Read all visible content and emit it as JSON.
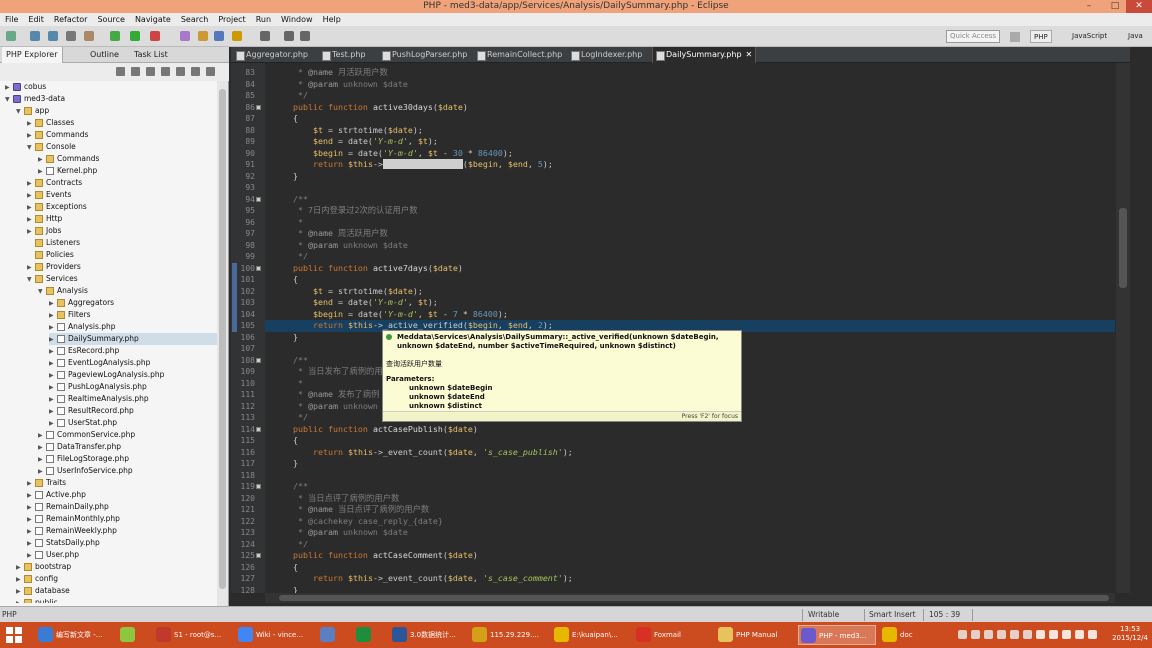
{
  "window": {
    "title": "PHP - med3-data/app/Services/Analysis/DailySummary.php - Eclipse",
    "minimize": "–",
    "maximize": "□",
    "close": "✕"
  },
  "menu": [
    "File",
    "Edit",
    "Refactor",
    "Source",
    "Navigate",
    "Search",
    "Project",
    "Run",
    "Window",
    "Help"
  ],
  "toolbar": {
    "quick_access": "Quick Access",
    "perspectives": [
      "PHP",
      "JavaScript",
      "Java"
    ]
  },
  "explorer": {
    "tabs": [
      "PHP Explorer",
      "Outline",
      "Task List"
    ],
    "tree": [
      {
        "label": "cobus",
        "type": "proj",
        "depth": 0,
        "arrow": "▶"
      },
      {
        "label": "med3-data",
        "type": "proj",
        "depth": 0,
        "arrow": "▼"
      },
      {
        "label": "app",
        "type": "folder",
        "depth": 1,
        "arrow": "▼"
      },
      {
        "label": "Classes",
        "type": "folder",
        "depth": 2,
        "arrow": "▶"
      },
      {
        "label": "Commands",
        "type": "folder",
        "depth": 2,
        "arrow": "▶"
      },
      {
        "label": "Console",
        "type": "folder",
        "depth": 2,
        "arrow": "▼"
      },
      {
        "label": "Commands",
        "type": "folder",
        "depth": 3,
        "arrow": "▶"
      },
      {
        "label": "Kernel.php",
        "type": "php",
        "depth": 3,
        "arrow": "▶"
      },
      {
        "label": "Contracts",
        "type": "folder",
        "depth": 2,
        "arrow": "▶"
      },
      {
        "label": "Events",
        "type": "folder",
        "depth": 2,
        "arrow": "▶"
      },
      {
        "label": "Exceptions",
        "type": "folder",
        "depth": 2,
        "arrow": "▶"
      },
      {
        "label": "Http",
        "type": "folder",
        "depth": 2,
        "arrow": "▶"
      },
      {
        "label": "Jobs",
        "type": "folder",
        "depth": 2,
        "arrow": "▶"
      },
      {
        "label": "Listeners",
        "type": "folder",
        "depth": 2,
        "arrow": ""
      },
      {
        "label": "Policies",
        "type": "folder",
        "depth": 2,
        "arrow": ""
      },
      {
        "label": "Providers",
        "type": "folder",
        "depth": 2,
        "arrow": "▶"
      },
      {
        "label": "Services",
        "type": "folder",
        "depth": 2,
        "arrow": "▼"
      },
      {
        "label": "Analysis",
        "type": "folder",
        "depth": 3,
        "arrow": "▼"
      },
      {
        "label": "Aggregators",
        "type": "folder",
        "depth": 4,
        "arrow": "▶"
      },
      {
        "label": "Filters",
        "type": "folder",
        "depth": 4,
        "arrow": "▶"
      },
      {
        "label": "Analysis.php",
        "type": "php",
        "depth": 4,
        "arrow": "▶"
      },
      {
        "label": "DailySummary.php",
        "type": "php",
        "depth": 4,
        "arrow": "▶",
        "selected": true
      },
      {
        "label": "EsRecord.php",
        "type": "php",
        "depth": 4,
        "arrow": "▶"
      },
      {
        "label": "EventLogAnalysis.php",
        "type": "php",
        "depth": 4,
        "arrow": "▶"
      },
      {
        "label": "PageviewLogAnalysis.php",
        "type": "php",
        "depth": 4,
        "arrow": "▶"
      },
      {
        "label": "PushLogAnalysis.php",
        "type": "php",
        "depth": 4,
        "arrow": "▶"
      },
      {
        "label": "RealtimeAnalysis.php",
        "type": "php",
        "depth": 4,
        "arrow": "▶"
      },
      {
        "label": "ResultRecord.php",
        "type": "php",
        "depth": 4,
        "arrow": "▶"
      },
      {
        "label": "UserStat.php",
        "type": "php",
        "depth": 4,
        "arrow": "▶"
      },
      {
        "label": "CommonService.php",
        "type": "php",
        "depth": 3,
        "arrow": "▶"
      },
      {
        "label": "DataTransfer.php",
        "type": "php",
        "depth": 3,
        "arrow": "▶"
      },
      {
        "label": "FileLogStorage.php",
        "type": "php",
        "depth": 3,
        "arrow": "▶"
      },
      {
        "label": "UserInfoService.php",
        "type": "php",
        "depth": 3,
        "arrow": "▶"
      },
      {
        "label": "Traits",
        "type": "folder",
        "depth": 2,
        "arrow": "▶"
      },
      {
        "label": "Active.php",
        "type": "php",
        "depth": 2,
        "arrow": "▶"
      },
      {
        "label": "RemainDaily.php",
        "type": "php",
        "depth": 2,
        "arrow": "▶"
      },
      {
        "label": "RemainMonthly.php",
        "type": "php",
        "depth": 2,
        "arrow": "▶"
      },
      {
        "label": "RemainWeekly.php",
        "type": "php",
        "depth": 2,
        "arrow": "▶"
      },
      {
        "label": "StatsDaily.php",
        "type": "php",
        "depth": 2,
        "arrow": "▶"
      },
      {
        "label": "User.php",
        "type": "php",
        "depth": 2,
        "arrow": "▶"
      },
      {
        "label": "bootstrap",
        "type": "folder",
        "depth": 1,
        "arrow": "▶"
      },
      {
        "label": "config",
        "type": "folder",
        "depth": 1,
        "arrow": "▶"
      },
      {
        "label": "database",
        "type": "folder",
        "depth": 1,
        "arrow": "▶"
      },
      {
        "label": "public",
        "type": "folder",
        "depth": 1,
        "arrow": "▶"
      }
    ]
  },
  "editor": {
    "tabs": [
      "Aggregator.php",
      "Test.php",
      "PushLogParser.php",
      "RemainCollect.php",
      "LogIndexer.php",
      "DailySummary.php"
    ],
    "active_tab": 5,
    "close_glyph": "✕",
    "lines": [
      {
        "n": "83",
        "html": "<span class=\"cm\">   * </span><span class=\"cmtag\">@name</span><span class=\"cm\"> 月活跃用户数</span>"
      },
      {
        "n": "84",
        "html": "<span class=\"cm\">   * </span><span class=\"cmtag\">@param</span><span class=\"cm\"> unknown $date</span>"
      },
      {
        "n": "85",
        "html": "<span class=\"cm\">   */</span>"
      },
      {
        "n": "86",
        "html": "  <span class=\"kw\">public function</span> <span class=\"fn\">active30days</span>(<span class=\"var\">$date</span>)",
        "fold": true
      },
      {
        "n": "87",
        "html": "  {"
      },
      {
        "n": "88",
        "html": "      <span class=\"var\">$t</span> = strtotime(<span class=\"var\">$date</span>);"
      },
      {
        "n": "89",
        "html": "      <span class=\"var\">$end</span> = date(<span class=\"str\">'Y-m-d'</span>, <span class=\"var\">$t</span>);"
      },
      {
        "n": "90",
        "html": "      <span class=\"var\">$begin</span> = date(<span class=\"str\">'Y-m-d'</span>, <span class=\"var\">$t</span> - <span class=\"num\">30</span> * <span class=\"num\">86400</span>);"
      },
      {
        "n": "91",
        "html": "      <span class=\"kw\">return</span> <span class=\"var\">$this</span>-><span class=\"sel-hl\">_active_verified</span>(<span class=\"var\">$begin</span>, <span class=\"var\">$end</span>, <span class=\"num\">5</span>);"
      },
      {
        "n": "92",
        "html": "  }"
      },
      {
        "n": "93",
        "html": ""
      },
      {
        "n": "94",
        "html": "<span class=\"cm\">  /**</span>",
        "fold": true
      },
      {
        "n": "95",
        "html": "<span class=\"cm\">   * 7日内登录过2次的认证用户数</span>"
      },
      {
        "n": "96",
        "html": "<span class=\"cm\">   *</span>"
      },
      {
        "n": "97",
        "html": "<span class=\"cm\">   * </span><span class=\"cmtag\">@name</span><span class=\"cm\"> 周活跃用户数</span>"
      },
      {
        "n": "98",
        "html": "<span class=\"cm\">   * </span><span class=\"cmtag\">@param</span><span class=\"cm\"> unknown $date</span>"
      },
      {
        "n": "99",
        "html": "<span class=\"cm\">   */</span>"
      },
      {
        "n": "100",
        "html": "  <span class=\"kw\">public function</span> <span class=\"fn\">active7days</span>(<span class=\"var\">$date</span>)",
        "fold": true
      },
      {
        "n": "101",
        "html": "  {"
      },
      {
        "n": "102",
        "html": "      <span class=\"var\">$t</span> = strtotime(<span class=\"var\">$date</span>);"
      },
      {
        "n": "103",
        "html": "      <span class=\"var\">$end</span> = date(<span class=\"str\">'Y-m-d'</span>, <span class=\"var\">$t</span>);"
      },
      {
        "n": "104",
        "html": "      <span class=\"var\">$begin</span> = date(<span class=\"str\">'Y-m-d'</span>, <span class=\"var\">$t</span> - <span class=\"num\">7</span> * <span class=\"num\">86400</span>);"
      },
      {
        "n": "105",
        "html": "      <span class=\"kw\">return</span> <span class=\"var\">$this</span>->_active_verified(<span class=\"var\">$begin</span>, <span class=\"var\">$end</span>, <span class=\"num\">2</span>);",
        "current": true
      },
      {
        "n": "106",
        "html": "  }"
      },
      {
        "n": "107",
        "html": ""
      },
      {
        "n": "108",
        "html": "<span class=\"cm\">  /**</span>",
        "fold": true
      },
      {
        "n": "109",
        "html": "<span class=\"cm\">   * 当日发布了病例的用户</span>"
      },
      {
        "n": "110",
        "html": "<span class=\"cm\">   *</span>"
      },
      {
        "n": "111",
        "html": "<span class=\"cm\">   * </span><span class=\"cmtag\">@name</span><span class=\"cm\"> 发布了病例</span>"
      },
      {
        "n": "112",
        "html": "<span class=\"cm\">   * </span><span class=\"cmtag\">@param</span><span class=\"cm\"> unknown</span>"
      },
      {
        "n": "113",
        "html": "<span class=\"cm\">   */</span>"
      },
      {
        "n": "114",
        "html": "  <span class=\"kw\">public function</span> <span class=\"fn\">actCasePublish</span>(<span class=\"var\">$date</span>)",
        "fold": true
      },
      {
        "n": "115",
        "html": "  {"
      },
      {
        "n": "116",
        "html": "      <span class=\"kw\">return</span> <span class=\"var\">$this</span>->_event_count(<span class=\"var\">$date</span>, <span class=\"str\">'s_case_publish'</span>);"
      },
      {
        "n": "117",
        "html": "  }"
      },
      {
        "n": "118",
        "html": ""
      },
      {
        "n": "119",
        "html": "<span class=\"cm\">  /**</span>",
        "fold": true
      },
      {
        "n": "120",
        "html": "<span class=\"cm\">   * 当日点评了病例的用户数</span>"
      },
      {
        "n": "121",
        "html": "<span class=\"cm\">   * </span><span class=\"cmtag\">@name</span><span class=\"cm\"> 当日点评了病例的用户数</span>"
      },
      {
        "n": "122",
        "html": "<span class=\"cm\">   * @cachekey case_reply_{date}</span>"
      },
      {
        "n": "123",
        "html": "<span class=\"cm\">   * </span><span class=\"cmtag\">@param</span><span class=\"cm\"> unknown $date</span>"
      },
      {
        "n": "124",
        "html": "<span class=\"cm\">   */</span>"
      },
      {
        "n": "125",
        "html": "  <span class=\"kw\">public function</span> <span class=\"fn\">actCaseComment</span>(<span class=\"var\">$date</span>)",
        "fold": true
      },
      {
        "n": "126",
        "html": "  {"
      },
      {
        "n": "127",
        "html": "      <span class=\"kw\">return</span> <span class=\"var\">$this</span>->_event_count(<span class=\"var\">$date</span>, <span class=\"str\">'s_case_comment'</span>);"
      },
      {
        "n": "128",
        "html": "  }"
      }
    ]
  },
  "tooltip": {
    "signature": "Meddata\\Services\\Analysis\\DailySummary::_active_verified(unknown $dateBegin, unknown $dateEnd, number $activeTimeRequired, unknown $distinct)",
    "description": "查询活跃用户数量",
    "params_label": "Parameters:",
    "params": [
      "unknown $dateBegin",
      "unknown $dateEnd",
      "unknown $distinct"
    ],
    "focus_hint": "Press 'F2' for focus"
  },
  "status": {
    "left": "PHP",
    "mode": "Writable",
    "insert": "Smart Insert",
    "position": "105 : 39"
  },
  "taskbar": {
    "items": [
      {
        "label": "编写新文章 -...",
        "color": "#3a7bd5"
      },
      {
        "label": "",
        "color": "#8dc63f"
      },
      {
        "label": "S1 - root@s...",
        "color": "#c0392b"
      },
      {
        "label": "Wiki - vince...",
        "color": "#4285f4"
      },
      {
        "label": "",
        "color": "#5b7fc0"
      },
      {
        "label": "",
        "color": "#1e8e3e"
      },
      {
        "label": "3.0数据统计...",
        "color": "#2b579a"
      },
      {
        "label": "115.29.229....",
        "color": "#d4a017"
      },
      {
        "label": "E:\\kuaipan\\...",
        "color": "#e6b800"
      },
      {
        "label": "Foxmail",
        "color": "#d93025"
      },
      {
        "label": "PHP Manual",
        "color": "#e8c25d"
      },
      {
        "label": "PHP - med3...",
        "color": "#6a5acd"
      },
      {
        "label": "doc",
        "color": "#e6b800"
      }
    ],
    "time": "13:53",
    "date": "2015/12/4"
  }
}
